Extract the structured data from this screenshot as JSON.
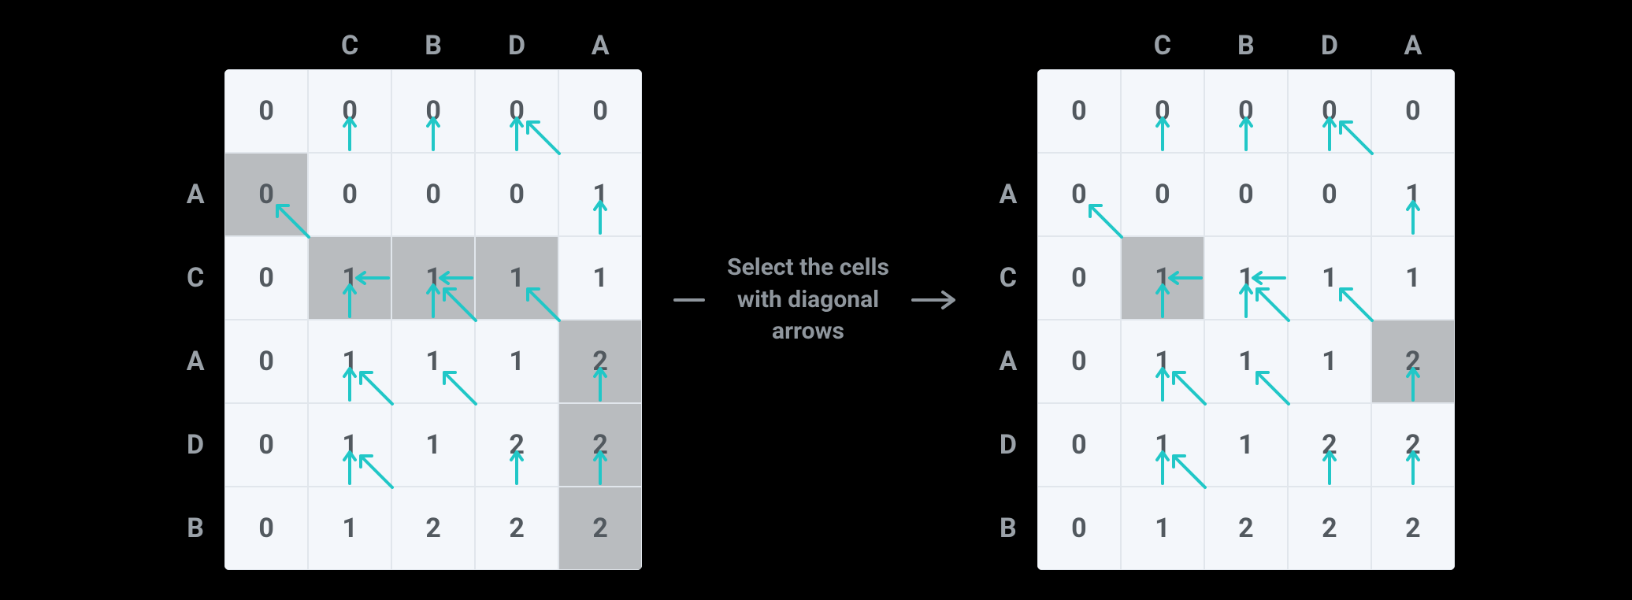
{
  "arrow_color": "#21c7c7",
  "caption": "Select the cells\nwith diagonal\narrows",
  "col_headers": [
    "",
    "C",
    "B",
    "D",
    "A"
  ],
  "row_headers": [
    "",
    "A",
    "C",
    "A",
    "D",
    "B"
  ],
  "cells": [
    [
      {
        "v": "0"
      },
      {
        "v": "0"
      },
      {
        "v": "0"
      },
      {
        "v": "0"
      },
      {
        "v": "0"
      }
    ],
    [
      {
        "v": "0"
      },
      {
        "v": "0",
        "a": "up"
      },
      {
        "v": "0",
        "a": "up"
      },
      {
        "v": "0",
        "a": "up"
      },
      {
        "v": "1",
        "a": "diag"
      }
    ],
    [
      {
        "v": "0"
      },
      {
        "v": "1",
        "a": "diag"
      },
      {
        "v": "1",
        "a": "left"
      },
      {
        "v": "1",
        "a": "left"
      },
      {
        "v": "1",
        "a": "up"
      }
    ],
    [
      {
        "v": "0"
      },
      {
        "v": "1",
        "a": "up"
      },
      {
        "v": "1",
        "a": "up"
      },
      {
        "v": "1",
        "a": "diag"
      },
      {
        "v": "2",
        "a": "diag"
      }
    ],
    [
      {
        "v": "0"
      },
      {
        "v": "1",
        "a": "up"
      },
      {
        "v": "1",
        "a": "diag"
      },
      {
        "v": "2",
        "a": "diag"
      },
      {
        "v": "2",
        "a": "up"
      }
    ],
    [
      {
        "v": "0"
      },
      {
        "v": "1",
        "a": "up"
      },
      {
        "v": "2",
        "a": "diag"
      },
      {
        "v": "2",
        "a": "up"
      },
      {
        "v": "2",
        "a": "up"
      }
    ]
  ],
  "left_shaded": [
    [
      1,
      0
    ],
    [
      2,
      1
    ],
    [
      2,
      2
    ],
    [
      2,
      3
    ],
    [
      3,
      4
    ],
    [
      4,
      4
    ],
    [
      5,
      4
    ]
  ],
  "right_shaded": [
    [
      2,
      1
    ],
    [
      3,
      4
    ]
  ]
}
